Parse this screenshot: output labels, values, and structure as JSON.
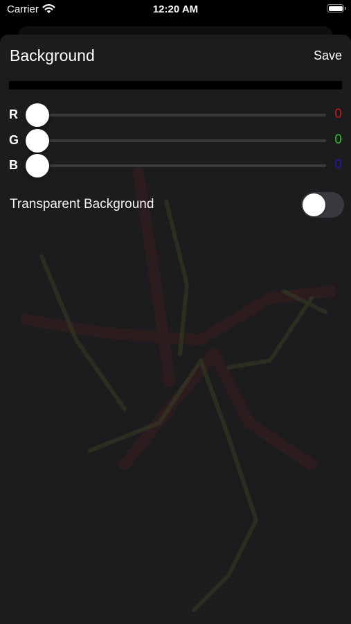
{
  "status_bar": {
    "carrier": "Carrier",
    "time": "12:20 AM"
  },
  "sheet": {
    "title": "Background",
    "save_label": "Save"
  },
  "preview": {
    "color": "#000000"
  },
  "sliders": [
    {
      "label": "R",
      "value": "0",
      "level": 0,
      "color": "#c41a1a"
    },
    {
      "label": "G",
      "value": "0",
      "level": 0,
      "color": "#2ec02e"
    },
    {
      "label": "B",
      "value": "0",
      "level": 0,
      "color": "#1c1cae"
    }
  ],
  "transparent": {
    "label": "Transparent Background",
    "on": false
  },
  "icons": [
    "wifi-icon",
    "battery-icon"
  ]
}
